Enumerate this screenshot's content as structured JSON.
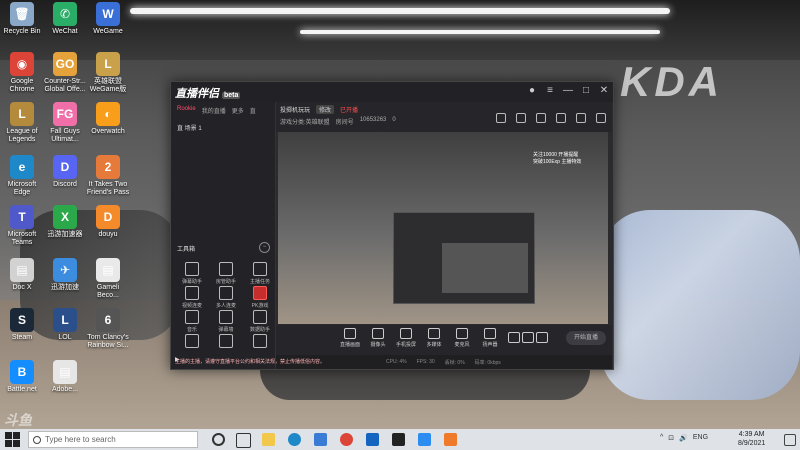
{
  "desktop_icons": [
    {
      "label": "Recycle Bin",
      "color": "#8aa9c9",
      "glyph": "🗑"
    },
    {
      "label": "WeChat",
      "color": "#2aae67",
      "glyph": "✆"
    },
    {
      "label": "WeGame",
      "color": "#3b6fd8",
      "glyph": "W"
    },
    {
      "label": "Google Chrome",
      "color": "#db4437",
      "glyph": "◉"
    },
    {
      "label": "Counter-Str... Global Offe...",
      "color": "#e5a13a",
      "glyph": "GO"
    },
    {
      "label": "英雄联盟 WeGame版",
      "color": "#c8a14a",
      "glyph": "L"
    },
    {
      "label": "League of Legends",
      "color": "#b48a3c",
      "glyph": "L"
    },
    {
      "label": "Fall Guys Ultimat...",
      "color": "#f06fa9",
      "glyph": "FG"
    },
    {
      "label": "Overwatch",
      "color": "#f99e1a",
      "glyph": "◐"
    },
    {
      "label": "Microsoft Edge",
      "color": "#1e88c8",
      "glyph": "e"
    },
    {
      "label": "Discord",
      "color": "#5865f2",
      "glyph": "D"
    },
    {
      "label": "It Takes Two Friend's Pass",
      "color": "#e67a3a",
      "glyph": "2"
    },
    {
      "label": "Microsoft Teams",
      "color": "#5059c9",
      "glyph": "T"
    },
    {
      "label": "迅游加速器",
      "color": "#2aa84a",
      "glyph": "X"
    },
    {
      "label": "douyu",
      "color": "#f58a2b",
      "glyph": "D"
    },
    {
      "label": "Doc X",
      "color": "#d2d2d2",
      "glyph": "▤"
    },
    {
      "label": "迅游加速",
      "color": "#3c8de0",
      "glyph": "✈"
    },
    {
      "label": "Gameli Beco...",
      "color": "#e9e9e9",
      "glyph": "▤"
    },
    {
      "label": "Steam",
      "color": "#1b2838",
      "glyph": "S"
    },
    {
      "label": "LOL",
      "color": "#2a4f8a",
      "glyph": "L"
    },
    {
      "label": "Tom Clancy's Rainbow Si...",
      "color": "#555555",
      "glyph": "6"
    },
    {
      "label": "Battle.net",
      "color": "#148eff",
      "glyph": "B"
    },
    {
      "label": "Adobe...",
      "color": "#e6e6e6",
      "glyph": "▤"
    }
  ],
  "wallpaper": {
    "logo": "KDA"
  },
  "app": {
    "brand": "直播伴侣",
    "brand_tag": "beta",
    "sidebar_tabs": [
      {
        "label": "Rookie"
      },
      {
        "label": "我的直播"
      },
      {
        "label": "更多"
      },
      {
        "label": "直"
      }
    ],
    "scene": "直 场景 1",
    "toolbox_title": "工具箱",
    "tools": [
      {
        "label": "弹幕助手",
        "red": false
      },
      {
        "label": "房管助手",
        "red": false
      },
      {
        "label": "主播任务",
        "red": false
      },
      {
        "label": "视频连麦",
        "red": false
      },
      {
        "label": "多人连麦",
        "red": false
      },
      {
        "label": "PK游戏",
        "red": true
      },
      {
        "label": "音乐",
        "red": false
      },
      {
        "label": "弹幕墙",
        "red": false
      },
      {
        "label": "数据助手",
        "red": false
      },
      {
        "label": "",
        "red": false
      },
      {
        "label": "",
        "red": false
      },
      {
        "label": "",
        "red": false
      }
    ],
    "header": {
      "title": "投掷机玩玩",
      "chip": "修改",
      "red_text": "已开播",
      "category": "游戏分类:英雄联盟",
      "room_label": "房间号",
      "room_id": "10653263",
      "viewers": "0"
    },
    "preview_overlay": [
      "关注10000 开播提醒",
      "突破100Exp 主播特效"
    ],
    "controls": [
      {
        "label": "直播画面"
      },
      {
        "label": "摄像头"
      },
      {
        "label": "手机投屏"
      },
      {
        "label": "多媒体"
      },
      {
        "label": "麦克风"
      },
      {
        "label": "扬声器"
      }
    ],
    "live_button": "开始直播",
    "notice": "主播的主播，请遵守直播平台公约和相关法规，禁止传播低俗内容。",
    "status": [
      "CPU: 4%",
      "FPS: 30",
      "丢帧: 0%",
      "码率: 0kbps"
    ]
  },
  "taskbar": {
    "search_placeholder": "Type here to search",
    "time": "4:39 AM",
    "date": "8/9/2021",
    "tray": [
      "^",
      "⊡",
      "🔊",
      "ENG"
    ]
  },
  "watermark": "斗鱼"
}
